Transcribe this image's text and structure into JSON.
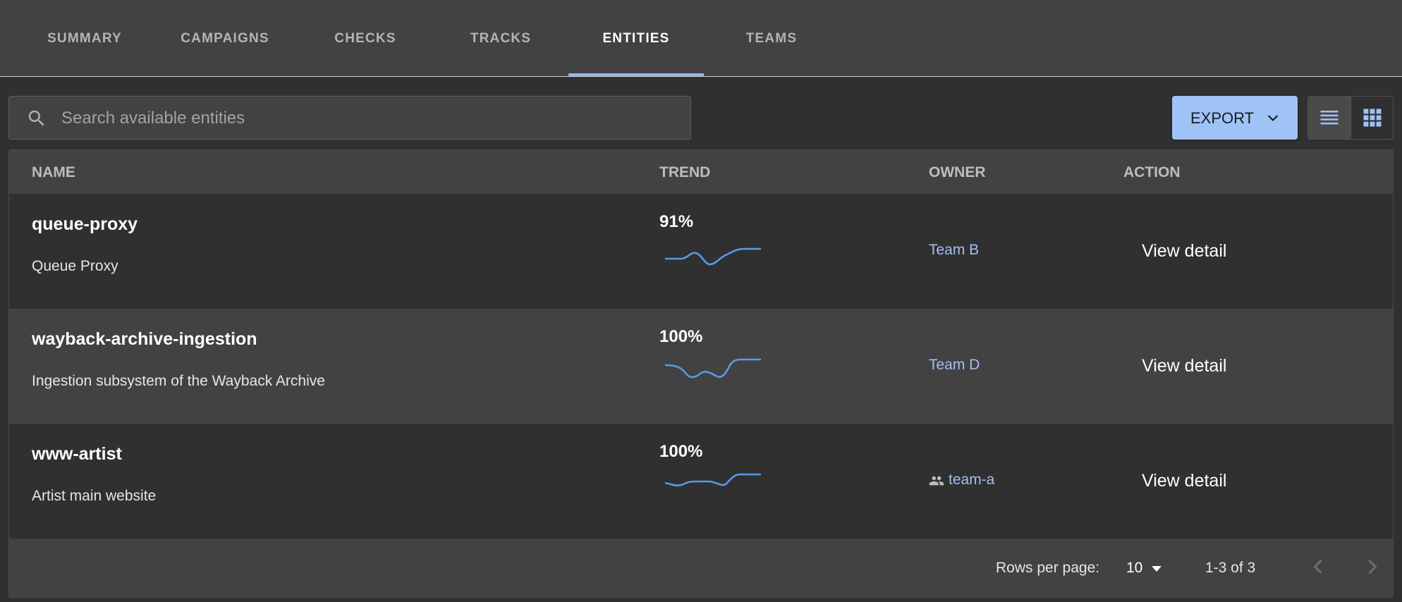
{
  "tabs": [
    {
      "label": "SUMMARY"
    },
    {
      "label": "CAMPAIGNS"
    },
    {
      "label": "CHECKS"
    },
    {
      "label": "TRACKS"
    },
    {
      "label": "ENTITIES",
      "active": true
    },
    {
      "label": "TEAMS"
    }
  ],
  "search": {
    "placeholder": "Search available entities",
    "value": ""
  },
  "toolbar": {
    "export_label": "EXPORT",
    "view_modes": [
      "list",
      "grid"
    ],
    "active_view": "list"
  },
  "table": {
    "headers": [
      "NAME",
      "TREND",
      "OWNER",
      "ACTION"
    ],
    "rows": [
      {
        "name": "queue-proxy",
        "description": "Queue Proxy",
        "trend": "91%",
        "owner": "Team B",
        "owner_icon": "",
        "action": "View detail"
      },
      {
        "name": "wayback-archive-ingestion",
        "description": "Ingestion subsystem of the Wayback Archive",
        "trend": "100%",
        "owner": "Team D",
        "owner_icon": "",
        "action": "View detail"
      },
      {
        "name": "www-artist",
        "description": "Artist main website",
        "trend": "100%",
        "owner": "team-a",
        "owner_icon": "group-icon",
        "action": "View detail"
      }
    ]
  },
  "pagination": {
    "rows_per_page_label": "Rows per page:",
    "rows_per_page": "10",
    "range": "1-3 of 3"
  },
  "colors": {
    "accent": "#9fc3f7",
    "link": "#9ec0f0",
    "sparkline": "#5a9ae6",
    "background": "#303030",
    "surface": "#424242"
  }
}
